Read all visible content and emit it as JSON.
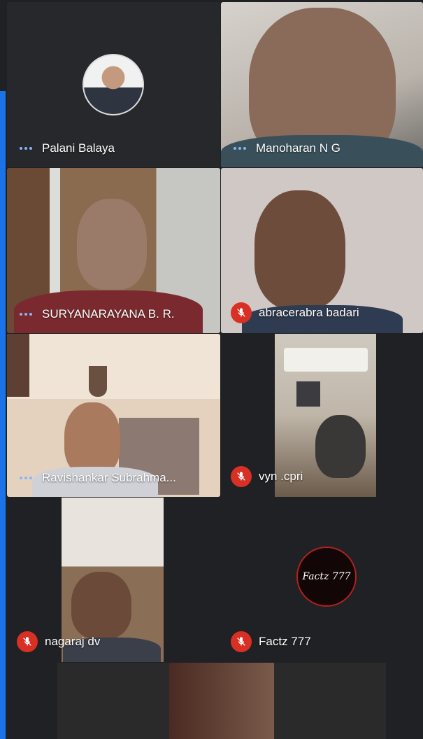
{
  "participants": [
    {
      "name": "Palani Balaya",
      "status": "speaking-indicator"
    },
    {
      "name": "Manoharan N G",
      "status": "speaking-indicator"
    },
    {
      "name": "SURYANARAYANA B. R.",
      "status": "speaking-indicator"
    },
    {
      "name": "abracerabra badari",
      "status": "muted"
    },
    {
      "name": "Ravishankar Subrahma...",
      "status": "speaking-indicator"
    },
    {
      "name": "vyn .cpri",
      "status": "muted"
    },
    {
      "name": "nagaraj dv",
      "status": "muted"
    },
    {
      "name": "Factz 777",
      "status": "muted"
    }
  ],
  "factz_logo_text": "Factz 777",
  "colors": {
    "muted_badge": "#d93025",
    "indicator": "#8ab4f8",
    "background": "#202124"
  }
}
